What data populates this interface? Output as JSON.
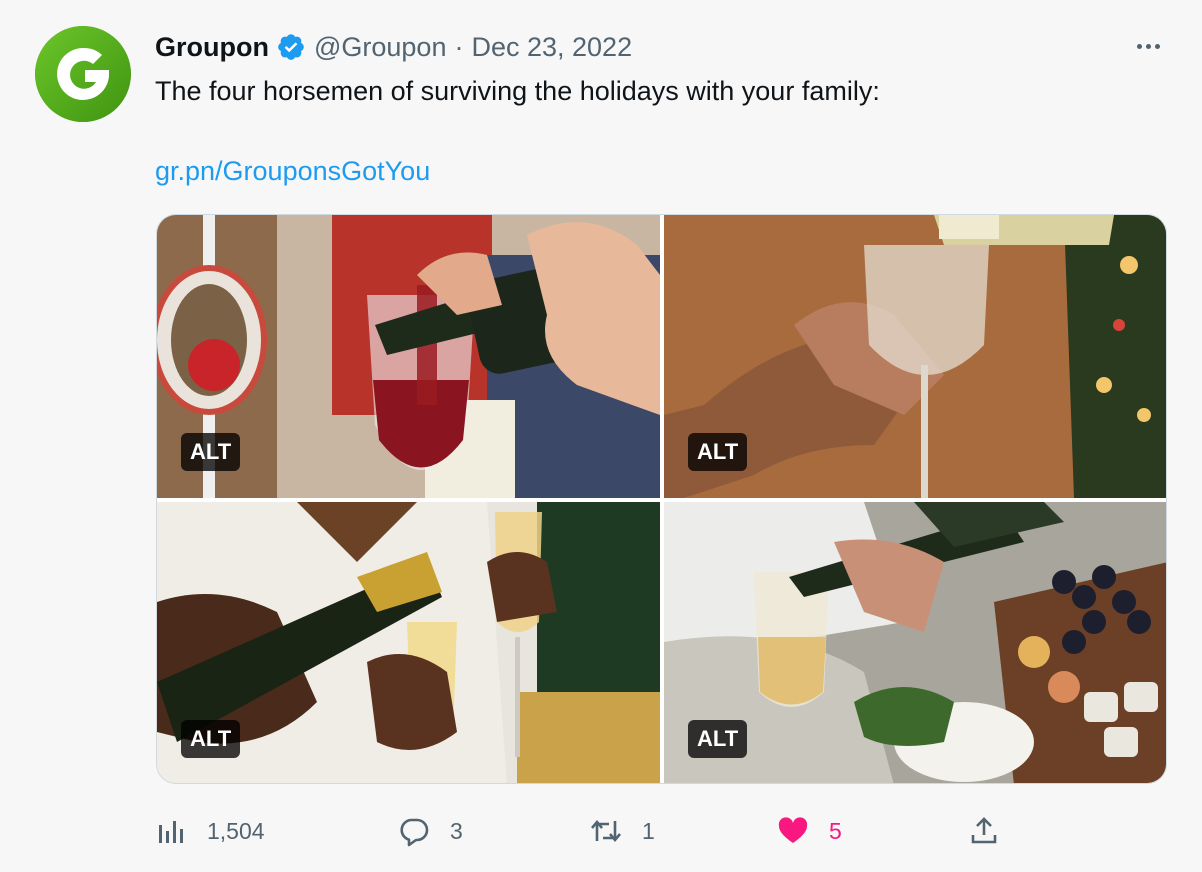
{
  "tweet": {
    "author_name": "Groupon",
    "handle": "@Groupon",
    "separator": "·",
    "date": "Dec 23, 2022",
    "text": "The four horsemen of surviving the holidays with your family:",
    "link": "gr.pn/GrouponsGotYou"
  },
  "avatar": {
    "icon": "groupon-logo-icon",
    "bg_color": "#53a318"
  },
  "media": [
    {
      "alt_badge": "ALT",
      "content": "red-wine-pour-photo"
    },
    {
      "alt_badge": "ALT",
      "content": "white-wine-pour-photo"
    },
    {
      "alt_badge": "ALT",
      "content": "champagne-pour-photo"
    },
    {
      "alt_badge": "ALT",
      "content": "wine-pour-cheese-board-photo"
    }
  ],
  "actions": {
    "views": {
      "icon": "analytics-icon",
      "count": "1,504"
    },
    "replies": {
      "icon": "reply-icon",
      "count": "3"
    },
    "retweets": {
      "icon": "retweet-icon",
      "count": "1"
    },
    "likes": {
      "icon": "heart-filled-icon",
      "count": "5",
      "color": "#f91880"
    },
    "share": {
      "icon": "share-icon"
    }
  },
  "colors": {
    "link": "#1d9bf0",
    "secondary_text": "#536471",
    "verified": "#1d9bf0",
    "background": "#f7f7f7"
  }
}
